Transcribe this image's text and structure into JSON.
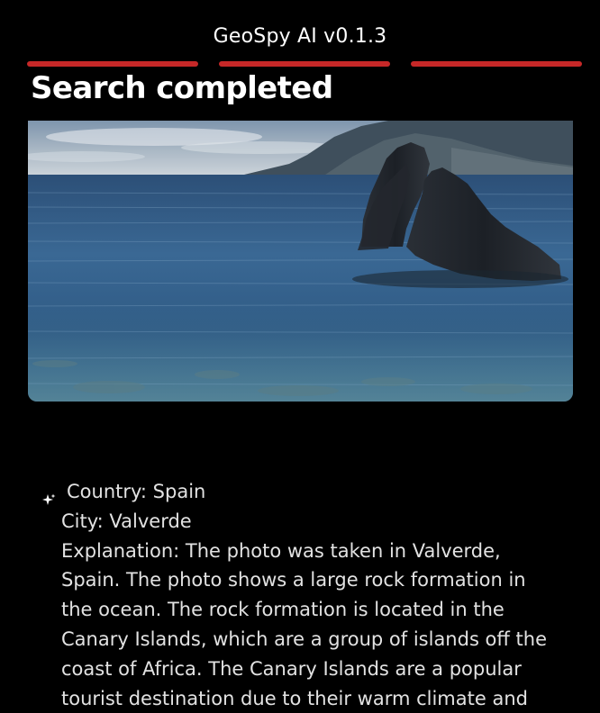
{
  "app": {
    "title": "GeoSpy AI v0.1.3",
    "accent_color": "#c62828",
    "progress_steps": 3
  },
  "status": {
    "heading": "Search completed"
  },
  "photo": {
    "icon": "uploaded-photo-image",
    "alt": "Rock formation in the ocean"
  },
  "result": {
    "icon": "sparkle-icon",
    "country_label": "Country:",
    "country": "Spain",
    "city_label": "City:",
    "city": "Valverde",
    "explanation_label": "Explanation:",
    "explanation_lines": [
      "Explanation: The photo was taken in Valverde,",
      "Spain. The photo shows a large rock formation in",
      "the ocean. The rock formation is located in the",
      "Canary Islands, which are a group of islands off the",
      "coast of Africa. The Canary Islands are a popular",
      "tourist destination due to their warm climate and"
    ]
  }
}
